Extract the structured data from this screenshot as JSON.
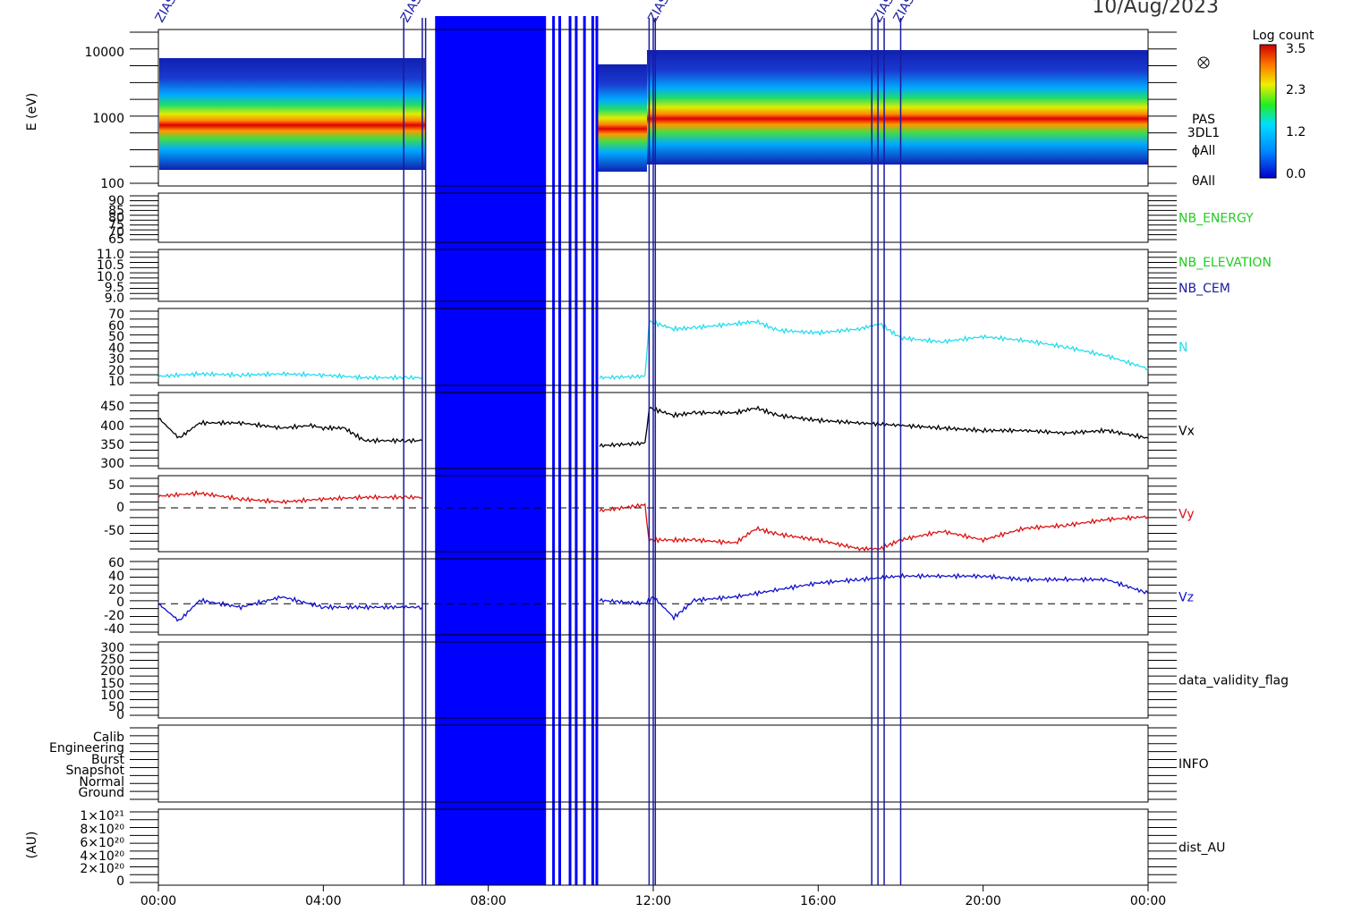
{
  "date_label": "10/Aug/2023",
  "colorbar": {
    "title": "Log count",
    "ticks": [
      "3.5",
      "2.3",
      "1.2",
      "0.0"
    ],
    "max": 3.5,
    "min": 0.0
  },
  "x_ticks": [
    "00:00",
    "04:00",
    "08:00",
    "12:00",
    "16:00",
    "20:00",
    "00:00"
  ],
  "marker_label": "ZIAS",
  "panels": [
    {
      "id": "spectrogram",
      "ylabel": "E (eV)",
      "right_labels": [
        "PAS",
        "3DL1",
        "ϕAll",
        "θAll"
      ],
      "ticks": [
        "10000",
        "1000",
        "100"
      ]
    },
    {
      "id": "nb-energy",
      "right_labels": [
        "NB_ENERGY"
      ],
      "ticks": [
        "90",
        "85",
        "80",
        "75",
        "70",
        "65"
      ]
    },
    {
      "id": "nb-elevation-cem",
      "right_labels": [
        "NB_ELEVATION",
        "NB_CEM"
      ],
      "ticks": [
        "11.0",
        "10.5",
        "10.0",
        "9.5",
        "9.0"
      ]
    },
    {
      "id": "density",
      "right_labels": [
        "N"
      ],
      "ticks": [
        "70",
        "60",
        "50",
        "40",
        "30",
        "20",
        "10"
      ]
    },
    {
      "id": "vx",
      "right_labels": [
        "Vx"
      ],
      "ticks": [
        "450",
        "400",
        "350",
        "300"
      ]
    },
    {
      "id": "vy",
      "right_labels": [
        "Vy"
      ],
      "ticks": [
        "50",
        "0",
        "-50"
      ]
    },
    {
      "id": "vz",
      "right_labels": [
        "Vz"
      ],
      "ticks": [
        "60",
        "40",
        "20",
        "0",
        "-20",
        "-40"
      ]
    },
    {
      "id": "data-validity",
      "right_labels": [
        "data_validity_flag"
      ],
      "ticks": [
        "300",
        "250",
        "200",
        "150",
        "100",
        "50",
        "0"
      ]
    },
    {
      "id": "info",
      "right_labels": [
        "INFO"
      ],
      "ticks": [
        "Calib",
        "Engineering",
        "Burst",
        "Snapshot",
        "Normal",
        "Ground"
      ]
    },
    {
      "id": "dist-au",
      "ylabel": "(AU)",
      "right_labels": [
        "dist_AU"
      ],
      "ticks": [
        "1×10²¹",
        "8×10²⁰",
        "6×10²⁰",
        "4×10²⁰",
        "2×10²⁰",
        "0"
      ]
    }
  ],
  "colors": {
    "nb": "#22cc22",
    "cem": "#1a1aa0",
    "density": "#22ddee",
    "vx": "#000000",
    "vy": "#dd1111",
    "vz": "#1111cc",
    "marker": "#1a1aa0",
    "gap_fill": "#0000ff"
  },
  "chart_data": {
    "type": "line",
    "x_unit": "UT hours",
    "xlim": [
      0,
      24
    ],
    "gaps": [
      [
        6.45,
        10.7
      ]
    ],
    "markers_hours": [
      5.95,
      6.4,
      6.48,
      11.9,
      12.0,
      12.05,
      17.3,
      17.45,
      17.6,
      18.0
    ],
    "spectrogram": {
      "ylabel": "E (eV)",
      "ylim": [
        100,
        10000
      ],
      "log_scale": true,
      "peak_energy_eV": [
        [
          0,
          900
        ],
        [
          1,
          950
        ],
        [
          2,
          950
        ],
        [
          3,
          950
        ],
        [
          4,
          900
        ],
        [
          6.4,
          800
        ],
        [
          10.7,
          800
        ],
        [
          11.8,
          800
        ],
        [
          12.0,
          950
        ],
        [
          14,
          950
        ],
        [
          16,
          900
        ],
        [
          18,
          850
        ],
        [
          20,
          850
        ],
        [
          24,
          800
        ]
      ]
    },
    "series": [
      {
        "name": "NB_ENERGY",
        "ylim": [
          65,
          90
        ],
        "x": [
          0,
          24
        ],
        "y": [
          65.5,
          65.5
        ]
      },
      {
        "name": "NB_ELEVATION",
        "ylim": [
          9.0,
          11.0
        ],
        "x": [
          0,
          24
        ],
        "y": [
          9.0,
          9.0
        ]
      },
      {
        "name": "NB_CEM",
        "ylim": [
          9.0,
          11.0
        ],
        "x": [
          0,
          24
        ],
        "y": [
          11.0,
          11.0
        ]
      },
      {
        "name": "N",
        "ylim": [
          10,
          70
        ],
        "x": [
          0,
          1,
          2,
          3,
          4,
          5,
          6,
          6.4,
          10.7,
          11.8,
          11.9,
          12.5,
          13,
          14,
          14.5,
          15,
          16,
          17,
          17.5,
          18,
          19,
          20,
          21,
          22,
          23,
          24
        ],
        "y": [
          17,
          19,
          18,
          19,
          18,
          16,
          16,
          16,
          16,
          17,
          60,
          54,
          55,
          58,
          60,
          53,
          51,
          54,
          58,
          47,
          44,
          48,
          45,
          40,
          33,
          23
        ]
      },
      {
        "name": "Vx",
        "ylim": [
          300,
          450
        ],
        "x": [
          0,
          0.5,
          1,
          2,
          3,
          3.7,
          4,
          4.5,
          5,
          6,
          6.4,
          10.7,
          11.8,
          11.9,
          12.5,
          13,
          14,
          14.5,
          15,
          16,
          17,
          18,
          19,
          20,
          21,
          22,
          23,
          24
        ],
        "y": [
          400,
          360,
          390,
          390,
          380,
          385,
          380,
          380,
          355,
          355,
          355,
          345,
          350,
          420,
          405,
          410,
          410,
          420,
          405,
          395,
          390,
          385,
          380,
          375,
          375,
          370,
          375,
          360
        ]
      },
      {
        "name": "Vy",
        "ylim": [
          -75,
          55
        ],
        "x": [
          0,
          1,
          2,
          3,
          4,
          5,
          6,
          6.4,
          10.7,
          11.8,
          11.9,
          12.5,
          13,
          14,
          14.5,
          15,
          16,
          17,
          17.5,
          18,
          19,
          20,
          21,
          22,
          23,
          24
        ],
        "y": [
          20,
          25,
          15,
          10,
          15,
          18,
          18,
          18,
          -5,
          5,
          -55,
          -55,
          -55,
          -60,
          -35,
          -45,
          -55,
          -70,
          -70,
          -55,
          -40,
          -55,
          -35,
          -30,
          -20,
          -15
        ]
      },
      {
        "name": "Vz",
        "ylim": [
          -45,
          65
        ],
        "x": [
          0,
          0.5,
          1,
          2,
          3,
          4,
          5,
          6,
          6.4,
          10.7,
          11.8,
          12,
          12.5,
          13,
          14,
          15,
          16,
          17,
          18,
          19,
          20,
          21,
          22,
          23,
          24
        ],
        "y": [
          0,
          -25,
          5,
          -5,
          10,
          -5,
          -5,
          -5,
          -5,
          5,
          0,
          10,
          -20,
          5,
          10,
          20,
          30,
          35,
          40,
          40,
          40,
          35,
          35,
          35,
          15
        ]
      },
      {
        "name": "data_validity_flag",
        "ylim": [
          0,
          300
        ],
        "x": [],
        "y": []
      },
      {
        "name": "INFO",
        "x": [
          0,
          24
        ],
        "y": [
          "Ground",
          "Ground"
        ]
      },
      {
        "name": "dist_AU",
        "ylim": [
          0,
          1e+21
        ],
        "x": [
          0,
          24
        ],
        "y": [
          0,
          0
        ]
      }
    ]
  }
}
